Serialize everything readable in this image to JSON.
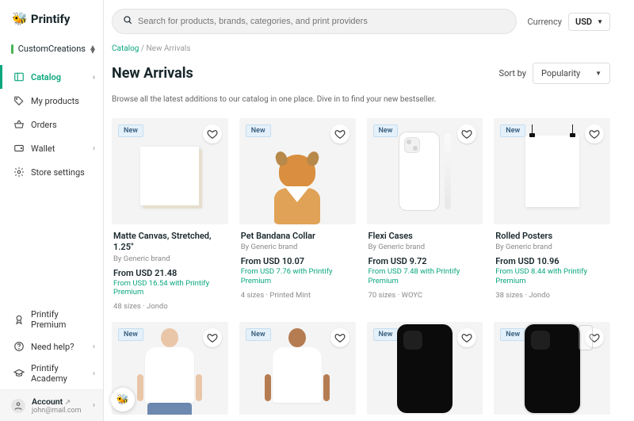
{
  "brand": "Printify",
  "store": "CustomCreations",
  "nav": {
    "catalog": "Catalog",
    "my_products": "My products",
    "orders": "Orders",
    "wallet": "Wallet",
    "store_settings": "Store settings"
  },
  "bottom_nav": {
    "premium": "Printify Premium",
    "help": "Need help?",
    "academy": "Printify Academy"
  },
  "account": {
    "label": "Account",
    "email": "john@mail.com"
  },
  "search": {
    "placeholder": "Search for products, brands, categories, and print providers"
  },
  "currency": {
    "label": "Currency",
    "value": "USD"
  },
  "breadcrumb": {
    "catalog": "Catalog",
    "sep": "/",
    "current": "New Arrivals"
  },
  "page": {
    "title": "New Arrivals",
    "description": "Browse all the latest additions to our catalog in one place. Dive in to find your new bestseller."
  },
  "sort": {
    "label": "Sort by",
    "value": "Popularity"
  },
  "badge_new": "New",
  "products": [
    {
      "name": "Matte Canvas, Stretched, 1.25\"",
      "brand": "By Generic brand",
      "price": "From USD 21.48",
      "premium": "From USD 16.54 with Printify Premium",
      "sizes": "48 sizes · Jondo"
    },
    {
      "name": "Pet Bandana Collar",
      "brand": "By Generic brand",
      "price": "From USD 10.07",
      "premium": "From USD 7.76 with Printify Premium",
      "sizes": "4 sizes · Printed Mint"
    },
    {
      "name": "Flexi Cases",
      "brand": "By Generic brand",
      "price": "From USD 9.72",
      "premium": "From USD 7.48 with Printify Premium",
      "sizes": "70 sizes · WOYC"
    },
    {
      "name": "Rolled Posters",
      "brand": "By Generic brand",
      "price": "From USD 10.96",
      "premium": "From USD 8.44 with Printify Premium",
      "sizes": "38 sizes · Jondo"
    }
  ]
}
